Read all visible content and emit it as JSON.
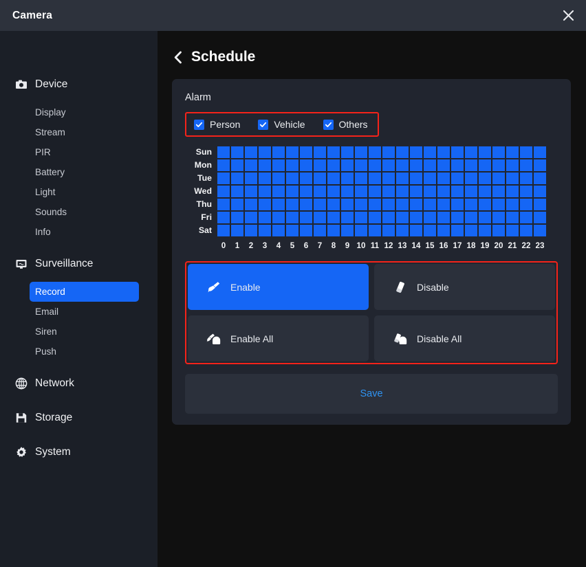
{
  "titlebar": {
    "app_title": "Camera",
    "close_icon": "close-icon"
  },
  "sidebar": {
    "groups": [
      {
        "label": "Device",
        "icon": "camera-icon",
        "items": [
          {
            "label": "Display",
            "active": false
          },
          {
            "label": "Stream",
            "active": false
          },
          {
            "label": "PIR",
            "active": false
          },
          {
            "label": "Battery",
            "active": false
          },
          {
            "label": "Light",
            "active": false
          },
          {
            "label": "Sounds",
            "active": false
          },
          {
            "label": "Info",
            "active": false
          }
        ]
      },
      {
        "label": "Surveillance",
        "icon": "monitor-icon",
        "items": [
          {
            "label": "Record",
            "active": true
          },
          {
            "label": "Email",
            "active": false
          },
          {
            "label": "Siren",
            "active": false
          },
          {
            "label": "Push",
            "active": false
          }
        ]
      },
      {
        "label": "Network",
        "icon": "globe-icon",
        "items": []
      },
      {
        "label": "Storage",
        "icon": "floppy-disk-icon",
        "items": []
      },
      {
        "label": "System",
        "icon": "gear-icon",
        "items": []
      }
    ]
  },
  "page": {
    "back_icon": "chevron-left-icon",
    "title": "Schedule"
  },
  "card": {
    "section_label": "Alarm",
    "detection_types": [
      {
        "label": "Person",
        "checked": true
      },
      {
        "label": "Vehicle",
        "checked": true
      },
      {
        "label": "Others",
        "checked": true
      }
    ],
    "schedule": {
      "days": [
        "Sun",
        "Mon",
        "Tue",
        "Wed",
        "Thu",
        "Fri",
        "Sat"
      ],
      "hours": [
        "0",
        "1",
        "2",
        "3",
        "4",
        "5",
        "6",
        "7",
        "8",
        "9",
        "10",
        "11",
        "12",
        "13",
        "14",
        "15",
        "16",
        "17",
        "18",
        "19",
        "20",
        "21",
        "22",
        "23"
      ],
      "enabled_cells": [
        [
          1,
          1,
          1,
          1,
          1,
          1,
          1,
          1,
          1,
          1,
          1,
          1,
          1,
          1,
          1,
          1,
          1,
          1,
          1,
          1,
          1,
          1,
          1,
          1
        ],
        [
          1,
          1,
          1,
          1,
          1,
          1,
          1,
          1,
          1,
          1,
          1,
          1,
          1,
          1,
          1,
          1,
          1,
          1,
          1,
          1,
          1,
          1,
          1,
          1
        ],
        [
          1,
          1,
          1,
          1,
          1,
          1,
          1,
          1,
          1,
          1,
          1,
          1,
          1,
          1,
          1,
          1,
          1,
          1,
          1,
          1,
          1,
          1,
          1,
          1
        ],
        [
          1,
          1,
          1,
          1,
          1,
          1,
          1,
          1,
          1,
          1,
          1,
          1,
          1,
          1,
          1,
          1,
          1,
          1,
          1,
          1,
          1,
          1,
          1,
          1
        ],
        [
          1,
          1,
          1,
          1,
          1,
          1,
          1,
          1,
          1,
          1,
          1,
          1,
          1,
          1,
          1,
          1,
          1,
          1,
          1,
          1,
          1,
          1,
          1,
          1
        ],
        [
          1,
          1,
          1,
          1,
          1,
          1,
          1,
          1,
          1,
          1,
          1,
          1,
          1,
          1,
          1,
          1,
          1,
          1,
          1,
          1,
          1,
          1,
          1,
          1
        ],
        [
          1,
          1,
          1,
          1,
          1,
          1,
          1,
          1,
          1,
          1,
          1,
          1,
          1,
          1,
          1,
          1,
          1,
          1,
          1,
          1,
          1,
          1,
          1,
          1
        ]
      ]
    },
    "actions": [
      {
        "label": "Enable",
        "icon": "brush-icon",
        "active": true
      },
      {
        "label": "Disable",
        "icon": "eraser-icon",
        "active": false
      },
      {
        "label": "Enable All",
        "icon": "brush-fill-all-icon",
        "active": false
      },
      {
        "label": "Disable All",
        "icon": "eraser-all-icon",
        "active": false
      }
    ],
    "save_label": "Save"
  },
  "colors": {
    "accent_blue": "#1566f5",
    "highlight_red": "#f5231a",
    "save_text": "#2f93f2",
    "titlebar_bg": "#2d323c",
    "sidebar_bg": "#1b1f27",
    "main_bg": "#101010",
    "card_bg": "#21252f",
    "button_bg": "#2b303b"
  }
}
